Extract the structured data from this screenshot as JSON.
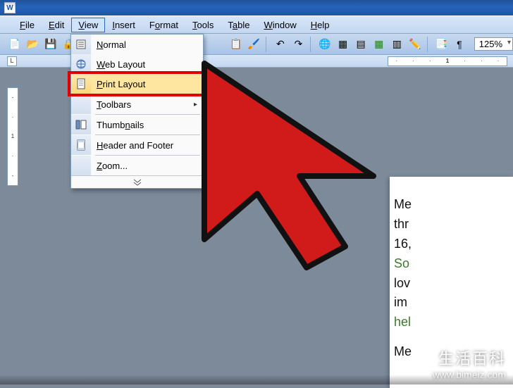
{
  "menubar": {
    "file": "File",
    "edit": "Edit",
    "view": "View",
    "insert": "Insert",
    "format": "Format",
    "tools": "Tools",
    "table": "Table",
    "window": "Window",
    "help": "Help"
  },
  "toolbar": {
    "zoom": "125%"
  },
  "view_menu": {
    "normal": "Normal",
    "web_layout": "Web Layout",
    "print_layout": "Print Layout",
    "toolbars": "Toolbars",
    "thumbnails": "Thumbnails",
    "header_footer": "Header and Footer",
    "zoom": "Zoom..."
  },
  "ruler_tab": "L",
  "document": {
    "l1": "Me",
    "l2": "thr",
    "l3": "16,",
    "l4": "So",
    "l5": "lov",
    "l6": "im",
    "l7": "hel",
    "l8": "Me"
  },
  "watermark": {
    "cn": "生活百科",
    "url": "www.bimeiz.com"
  }
}
